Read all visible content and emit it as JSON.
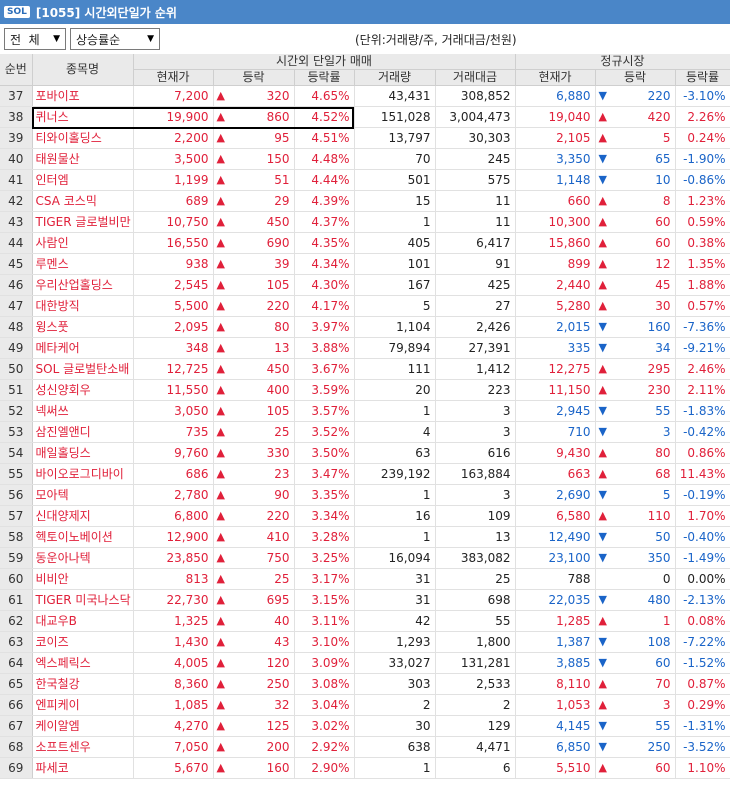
{
  "window": {
    "logo": "SOL",
    "title": "[1055] 시간외단일가 순위"
  },
  "toolbar": {
    "market_select": "전  체",
    "sort_select": "상승률순",
    "unit_note": "(단위:거래량/주, 거래대금/천원)"
  },
  "headers": {
    "rank": "순번",
    "name": "종목명",
    "group_afterhours": "시간외 단일가 매매",
    "group_regular": "정규시장",
    "price": "현재가",
    "change": "등락",
    "rate": "등락률",
    "volume": "거래량",
    "amount": "거래대금",
    "reg_price": "현재가",
    "reg_change": "등락",
    "reg_rate": "등락률"
  },
  "colors": {
    "up": "#e0203a",
    "down": "#1a64c8",
    "header_bg": "#eaeaea",
    "title_bg": "#4a86c8"
  },
  "highlighted_rank": "38",
  "rows": [
    {
      "rank": "37",
      "name": "포바이포",
      "price": "7,200",
      "dir": "up",
      "change": "320",
      "rate": "4.65%",
      "volume": "43,431",
      "amount": "308,852",
      "reg_price": "6,880",
      "reg_dir": "down",
      "reg_change": "220",
      "reg_rate": "-3.10%"
    },
    {
      "rank": "38",
      "name": "퀴너스",
      "price": "19,900",
      "dir": "up",
      "change": "860",
      "rate": "4.52%",
      "volume": "151,028",
      "amount": "3,004,473",
      "reg_price": "19,040",
      "reg_dir": "up",
      "reg_change": "420",
      "reg_rate": "2.26%"
    },
    {
      "rank": "39",
      "name": "티와이홀딩스",
      "price": "2,200",
      "dir": "up",
      "change": "95",
      "rate": "4.51%",
      "volume": "13,797",
      "amount": "30,303",
      "reg_price": "2,105",
      "reg_dir": "up",
      "reg_change": "5",
      "reg_rate": "0.24%"
    },
    {
      "rank": "40",
      "name": "태원물산",
      "price": "3,500",
      "dir": "up",
      "change": "150",
      "rate": "4.48%",
      "volume": "70",
      "amount": "245",
      "reg_price": "3,350",
      "reg_dir": "down",
      "reg_change": "65",
      "reg_rate": "-1.90%"
    },
    {
      "rank": "41",
      "name": "인터엠",
      "price": "1,199",
      "dir": "up",
      "change": "51",
      "rate": "4.44%",
      "volume": "501",
      "amount": "575",
      "reg_price": "1,148",
      "reg_dir": "down",
      "reg_change": "10",
      "reg_rate": "-0.86%"
    },
    {
      "rank": "42",
      "name": "CSA 코스믹",
      "price": "689",
      "dir": "up",
      "change": "29",
      "rate": "4.39%",
      "volume": "15",
      "amount": "11",
      "reg_price": "660",
      "reg_dir": "up",
      "reg_change": "8",
      "reg_rate": "1.23%"
    },
    {
      "rank": "43",
      "name": "TIGER 글로벌비만",
      "price": "10,750",
      "dir": "up",
      "change": "450",
      "rate": "4.37%",
      "volume": "1",
      "amount": "11",
      "reg_price": "10,300",
      "reg_dir": "up",
      "reg_change": "60",
      "reg_rate": "0.59%"
    },
    {
      "rank": "44",
      "name": "사람인",
      "price": "16,550",
      "dir": "up",
      "change": "690",
      "rate": "4.35%",
      "volume": "405",
      "amount": "6,417",
      "reg_price": "15,860",
      "reg_dir": "up",
      "reg_change": "60",
      "reg_rate": "0.38%"
    },
    {
      "rank": "45",
      "name": "루멘스",
      "price": "938",
      "dir": "up",
      "change": "39",
      "rate": "4.34%",
      "volume": "101",
      "amount": "91",
      "reg_price": "899",
      "reg_dir": "up",
      "reg_change": "12",
      "reg_rate": "1.35%"
    },
    {
      "rank": "46",
      "name": "우리산업홀딩스",
      "price": "2,545",
      "dir": "up",
      "change": "105",
      "rate": "4.30%",
      "volume": "167",
      "amount": "425",
      "reg_price": "2,440",
      "reg_dir": "up",
      "reg_change": "45",
      "reg_rate": "1.88%"
    },
    {
      "rank": "47",
      "name": "대한방직",
      "price": "5,500",
      "dir": "up",
      "change": "220",
      "rate": "4.17%",
      "volume": "5",
      "amount": "27",
      "reg_price": "5,280",
      "reg_dir": "up",
      "reg_change": "30",
      "reg_rate": "0.57%"
    },
    {
      "rank": "48",
      "name": "윙스풋",
      "price": "2,095",
      "dir": "up",
      "change": "80",
      "rate": "3.97%",
      "volume": "1,104",
      "amount": "2,426",
      "reg_price": "2,015",
      "reg_dir": "down",
      "reg_change": "160",
      "reg_rate": "-7.36%"
    },
    {
      "rank": "49",
      "name": "메타케어",
      "price": "348",
      "dir": "up",
      "change": "13",
      "rate": "3.88%",
      "volume": "79,894",
      "amount": "27,391",
      "reg_price": "335",
      "reg_dir": "down",
      "reg_change": "34",
      "reg_rate": "-9.21%"
    },
    {
      "rank": "50",
      "name": "SOL 글로벌탄소배",
      "price": "12,725",
      "dir": "up",
      "change": "450",
      "rate": "3.67%",
      "volume": "111",
      "amount": "1,412",
      "reg_price": "12,275",
      "reg_dir": "up",
      "reg_change": "295",
      "reg_rate": "2.46%"
    },
    {
      "rank": "51",
      "name": "성신양회우",
      "price": "11,550",
      "dir": "up",
      "change": "400",
      "rate": "3.59%",
      "volume": "20",
      "amount": "223",
      "reg_price": "11,150",
      "reg_dir": "up",
      "reg_change": "230",
      "reg_rate": "2.11%"
    },
    {
      "rank": "52",
      "name": "넥써쓰",
      "price": "3,050",
      "dir": "up",
      "change": "105",
      "rate": "3.57%",
      "volume": "1",
      "amount": "3",
      "reg_price": "2,945",
      "reg_dir": "down",
      "reg_change": "55",
      "reg_rate": "-1.83%"
    },
    {
      "rank": "53",
      "name": "삼진엘앤디",
      "price": "735",
      "dir": "up",
      "change": "25",
      "rate": "3.52%",
      "volume": "4",
      "amount": "3",
      "reg_price": "710",
      "reg_dir": "down",
      "reg_change": "3",
      "reg_rate": "-0.42%"
    },
    {
      "rank": "54",
      "name": "매일홀딩스",
      "price": "9,760",
      "dir": "up",
      "change": "330",
      "rate": "3.50%",
      "volume": "63",
      "amount": "616",
      "reg_price": "9,430",
      "reg_dir": "up",
      "reg_change": "80",
      "reg_rate": "0.86%"
    },
    {
      "rank": "55",
      "name": "바이오로그디바이",
      "price": "686",
      "dir": "up",
      "change": "23",
      "rate": "3.47%",
      "volume": "239,192",
      "amount": "163,884",
      "reg_price": "663",
      "reg_dir": "up",
      "reg_change": "68",
      "reg_rate": "11.43%"
    },
    {
      "rank": "56",
      "name": "모아텍",
      "price": "2,780",
      "dir": "up",
      "change": "90",
      "rate": "3.35%",
      "volume": "1",
      "amount": "3",
      "reg_price": "2,690",
      "reg_dir": "down",
      "reg_change": "5",
      "reg_rate": "-0.19%"
    },
    {
      "rank": "57",
      "name": "신대양제지",
      "price": "6,800",
      "dir": "up",
      "change": "220",
      "rate": "3.34%",
      "volume": "16",
      "amount": "109",
      "reg_price": "6,580",
      "reg_dir": "up",
      "reg_change": "110",
      "reg_rate": "1.70%"
    },
    {
      "rank": "58",
      "name": "헥토이노베이션",
      "price": "12,900",
      "dir": "up",
      "change": "410",
      "rate": "3.28%",
      "volume": "1",
      "amount": "13",
      "reg_price": "12,490",
      "reg_dir": "down",
      "reg_change": "50",
      "reg_rate": "-0.40%"
    },
    {
      "rank": "59",
      "name": "동운아나텍",
      "price": "23,850",
      "dir": "up",
      "change": "750",
      "rate": "3.25%",
      "volume": "16,094",
      "amount": "383,082",
      "reg_price": "23,100",
      "reg_dir": "down",
      "reg_change": "350",
      "reg_rate": "-1.49%"
    },
    {
      "rank": "60",
      "name": "비비안",
      "price": "813",
      "dir": "up",
      "change": "25",
      "rate": "3.17%",
      "volume": "31",
      "amount": "25",
      "reg_price": "788",
      "reg_dir": "flat",
      "reg_change": "0",
      "reg_rate": "0.00%"
    },
    {
      "rank": "61",
      "name": "TIGER 미국나스닥",
      "price": "22,730",
      "dir": "up",
      "change": "695",
      "rate": "3.15%",
      "volume": "31",
      "amount": "698",
      "reg_price": "22,035",
      "reg_dir": "down",
      "reg_change": "480",
      "reg_rate": "-2.13%"
    },
    {
      "rank": "62",
      "name": "대교우B",
      "price": "1,325",
      "dir": "up",
      "change": "40",
      "rate": "3.11%",
      "volume": "42",
      "amount": "55",
      "reg_price": "1,285",
      "reg_dir": "up",
      "reg_change": "1",
      "reg_rate": "0.08%"
    },
    {
      "rank": "63",
      "name": "코이즈",
      "price": "1,430",
      "dir": "up",
      "change": "43",
      "rate": "3.10%",
      "volume": "1,293",
      "amount": "1,800",
      "reg_price": "1,387",
      "reg_dir": "down",
      "reg_change": "108",
      "reg_rate": "-7.22%"
    },
    {
      "rank": "64",
      "name": "엑스페릭스",
      "price": "4,005",
      "dir": "up",
      "change": "120",
      "rate": "3.09%",
      "volume": "33,027",
      "amount": "131,281",
      "reg_price": "3,885",
      "reg_dir": "down",
      "reg_change": "60",
      "reg_rate": "-1.52%"
    },
    {
      "rank": "65",
      "name": "한국철강",
      "price": "8,360",
      "dir": "up",
      "change": "250",
      "rate": "3.08%",
      "volume": "303",
      "amount": "2,533",
      "reg_price": "8,110",
      "reg_dir": "up",
      "reg_change": "70",
      "reg_rate": "0.87%"
    },
    {
      "rank": "66",
      "name": "엔피케이",
      "price": "1,085",
      "dir": "up",
      "change": "32",
      "rate": "3.04%",
      "volume": "2",
      "amount": "2",
      "reg_price": "1,053",
      "reg_dir": "up",
      "reg_change": "3",
      "reg_rate": "0.29%"
    },
    {
      "rank": "67",
      "name": "케이알엠",
      "price": "4,270",
      "dir": "up",
      "change": "125",
      "rate": "3.02%",
      "volume": "30",
      "amount": "129",
      "reg_price": "4,145",
      "reg_dir": "down",
      "reg_change": "55",
      "reg_rate": "-1.31%"
    },
    {
      "rank": "68",
      "name": "소프트센우",
      "price": "7,050",
      "dir": "up",
      "change": "200",
      "rate": "2.92%",
      "volume": "638",
      "amount": "4,471",
      "reg_price": "6,850",
      "reg_dir": "down",
      "reg_change": "250",
      "reg_rate": "-3.52%"
    },
    {
      "rank": "69",
      "name": "파세코",
      "price": "5,670",
      "dir": "up",
      "change": "160",
      "rate": "2.90%",
      "volume": "1",
      "amount": "6",
      "reg_price": "5,510",
      "reg_dir": "up",
      "reg_change": "60",
      "reg_rate": "1.10%"
    }
  ]
}
